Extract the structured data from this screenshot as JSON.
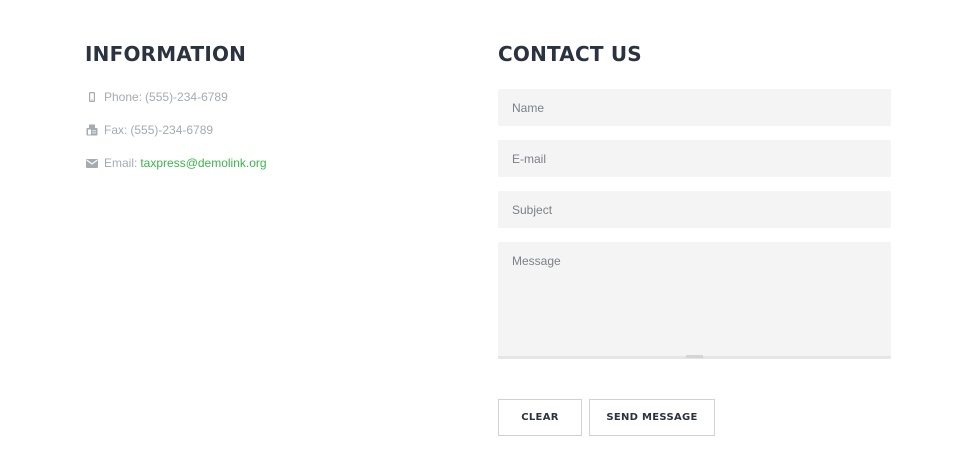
{
  "information": {
    "heading": "INFORMATION",
    "phone": {
      "icon": "mobile-phone-icon",
      "label": "Phone:",
      "value": "(555)-234-6789"
    },
    "fax": {
      "icon": "fax-icon",
      "label": "Fax:",
      "value": "(555)-234-6789"
    },
    "email": {
      "icon": "envelope-icon",
      "label": "Email:",
      "value": "taxpress@demolink.org"
    }
  },
  "contact": {
    "heading": "CONTACT US",
    "name_placeholder": "Name",
    "email_placeholder": "E-mail",
    "subject_placeholder": "Subject",
    "message_placeholder": "Message",
    "clear_label": "CLEAR",
    "send_label": "SEND MESSAGE"
  },
  "colors": {
    "heading": "#2b3240",
    "muted_text": "#a4abb3",
    "link": "#3bb54a",
    "field_bg": "#f4f4f4",
    "button_border": "#cfd3d7"
  }
}
